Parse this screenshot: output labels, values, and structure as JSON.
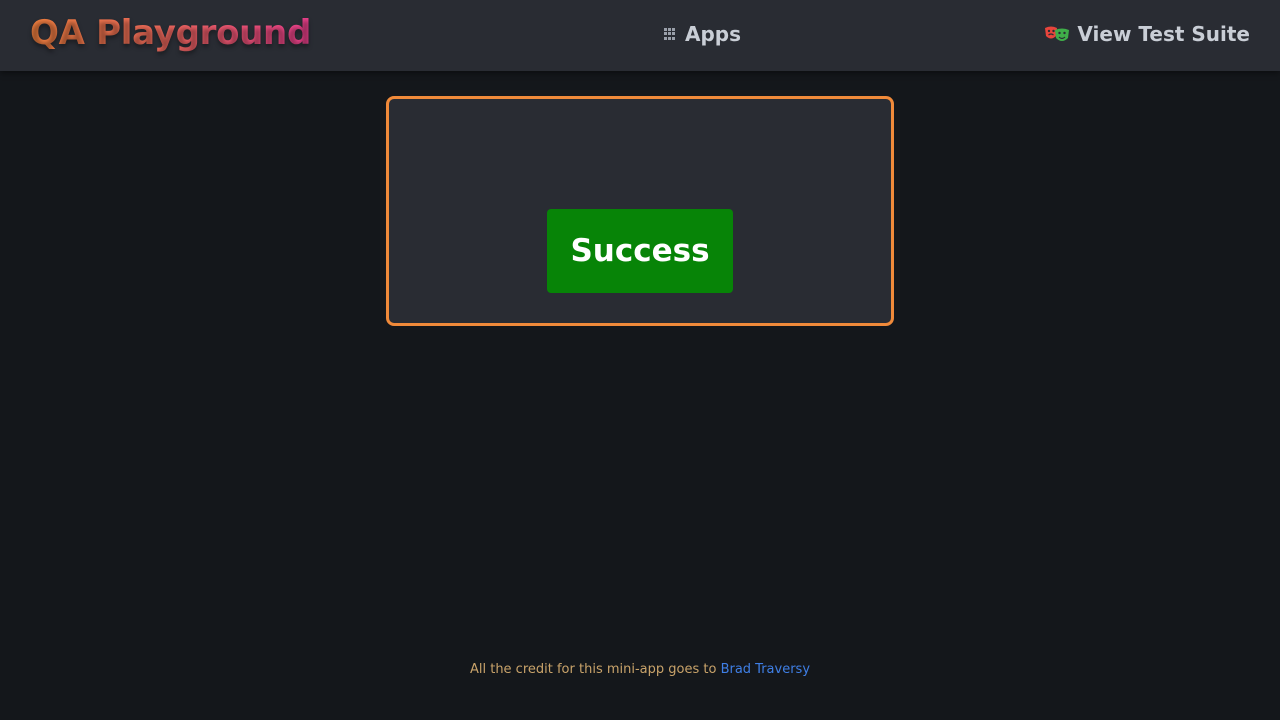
{
  "header": {
    "brand": "QA Playground",
    "apps_label": "Apps",
    "apps_icon": "grid-icon",
    "test_suite_label": "View Test Suite",
    "test_suite_icon": "theater-masks-icon"
  },
  "main": {
    "button_label": "Success",
    "button_color": "#078407",
    "card_border_color": "#f08a3a"
  },
  "footer": {
    "credit_text": "All the credit for this mini-app goes to",
    "credit_link": "Brad Traversy"
  }
}
